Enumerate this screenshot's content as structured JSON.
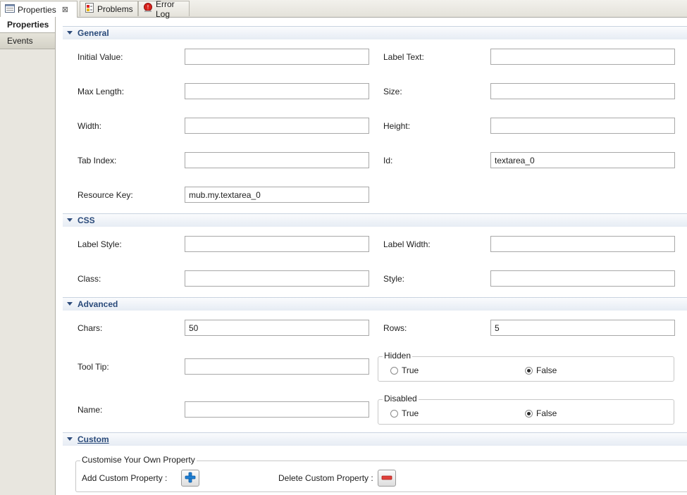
{
  "tabs": [
    {
      "label": "Properties",
      "close": "⊠"
    },
    {
      "label": "Problems"
    },
    {
      "label": "Error Log"
    }
  ],
  "categories": [
    "Properties",
    "Events"
  ],
  "sections": {
    "general": {
      "title": "General",
      "initial_value": {
        "label": "Initial Value:",
        "value": ""
      },
      "label_text": {
        "label": "Label Text:",
        "value": ""
      },
      "max_length": {
        "label": "Max Length:",
        "value": ""
      },
      "size": {
        "label": "Size:",
        "value": ""
      },
      "width": {
        "label": "Width:",
        "value": ""
      },
      "height": {
        "label": "Height:",
        "value": ""
      },
      "tab_index": {
        "label": "Tab Index:",
        "value": ""
      },
      "id": {
        "label": "Id:",
        "value": "textarea_0"
      },
      "resource_key": {
        "label": "Resource Key:",
        "value": "mub.my.textarea_0"
      }
    },
    "css": {
      "title": "CSS",
      "label_style": {
        "label": "Label Style:",
        "value": ""
      },
      "label_width": {
        "label": "Label Width:",
        "value": ""
      },
      "class": {
        "label": "Class:",
        "value": ""
      },
      "style": {
        "label": "Style:",
        "value": ""
      }
    },
    "advanced": {
      "title": "Advanced",
      "chars": {
        "label": "Chars:",
        "value": "50"
      },
      "rows": {
        "label": "Rows:",
        "value": "5"
      },
      "tool_tip": {
        "label": "Tool Tip:",
        "value": ""
      },
      "name": {
        "label": "Name:",
        "value": ""
      },
      "hidden": {
        "title": "Hidden",
        "true_label": "True",
        "false_label": "False",
        "selected": "False"
      },
      "disabled": {
        "title": "Disabled",
        "true_label": "True",
        "false_label": "False",
        "selected": "False"
      }
    },
    "custom": {
      "title": "Custom",
      "group_title": "Customise Your Own Property",
      "add_label": "Add Custom Property :",
      "delete_label": "Delete Custom Property :"
    }
  }
}
